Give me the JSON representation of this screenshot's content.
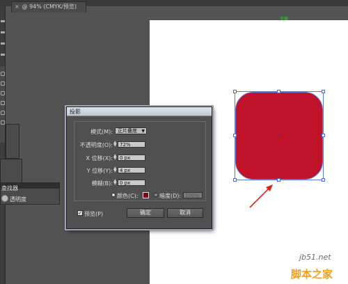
{
  "document": {
    "tab_close": "×",
    "tab_title": "@ 94% (CMYK/预览)"
  },
  "artboard": {
    "marker_label": "页面"
  },
  "panels": {
    "finder_label": "查找器",
    "opacity_label": "透明度"
  },
  "dialog": {
    "title": "投影",
    "mode_label": "模式(M):",
    "mode_value": "正片叠底",
    "opacity_label": "不透明度(O):",
    "opacity_value": "72%",
    "x_offset_label": "X 位移(X):",
    "x_offset_value": "0 px",
    "y_offset_label": "Y 位移(Y):",
    "y_offset_value": "4 px",
    "blur_label": "模糊(B):",
    "blur_value": "0 px",
    "color_label": "颜色(C):",
    "color_value": "#7a0a12",
    "darkness_label": "暗度(D):",
    "darkness_value": "100%",
    "preview_label": "预览(P)",
    "preview_checked": true,
    "ok_label": "确定",
    "cancel_label": "取消"
  },
  "shape": {
    "fill_color": "#c0132b",
    "selection_color": "#5a7bdb"
  },
  "annotation": {
    "arrow_color": "#e0201a"
  },
  "watermark": {
    "url": "jb51.net",
    "name": "脚本之家"
  }
}
